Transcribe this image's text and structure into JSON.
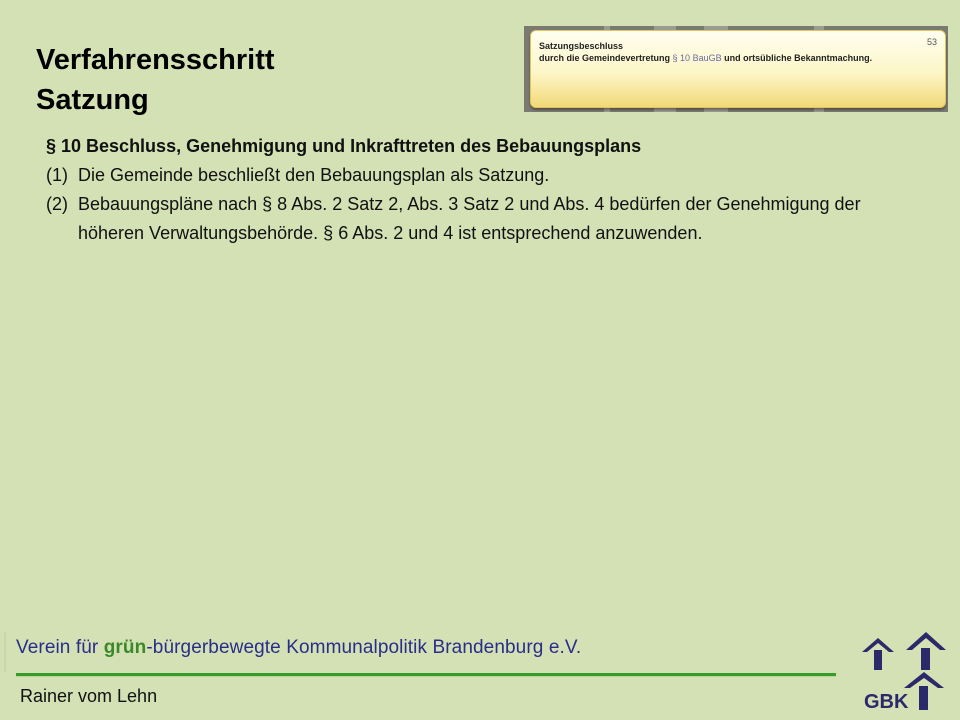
{
  "slide": {
    "title_line1": "Verfahrensschritt",
    "title_line2": "Satzung"
  },
  "thumbnail": {
    "title": "Satzungsbeschluss",
    "subtitle_pre": "durch die Gemeindevertretung",
    "subtitle_ref": "§ 10 BauGB",
    "subtitle_post": "und ortsübliche Bekanntmachung.",
    "page_number": "53"
  },
  "content": {
    "heading": "§ 10 Beschluss, Genehmigung und Inkrafttreten des Bebauungsplans",
    "items": [
      {
        "num": "(1)",
        "text": "Die Gemeinde beschließt den Bebauungsplan als Satzung."
      },
      {
        "num": "(2)",
        "text": "Bebauungspläne nach § 8 Abs. 2 Satz 2, Abs. 3 Satz 2 und Abs. 4 bedürfen der Genehmigung der höheren Verwaltungsbehörde. § 6 Abs. 2 und 4 ist entsprechend anzuwenden."
      }
    ]
  },
  "footer": {
    "org_pre": "Verein für ",
    "org_green": "grün",
    "org_post": "-bürgerbewegte Kommunalpolitik Brandenburg e.V.",
    "author": "Rainer vom Lehn",
    "logo_text": "GBK"
  },
  "colors": {
    "background": "#d4e1b5",
    "footer_blue": "#2a2d8a",
    "footer_green": "#3b8a2a",
    "logo_navy": "#2a2a6a"
  },
  "icons": [
    "house-arrow-icon"
  ]
}
